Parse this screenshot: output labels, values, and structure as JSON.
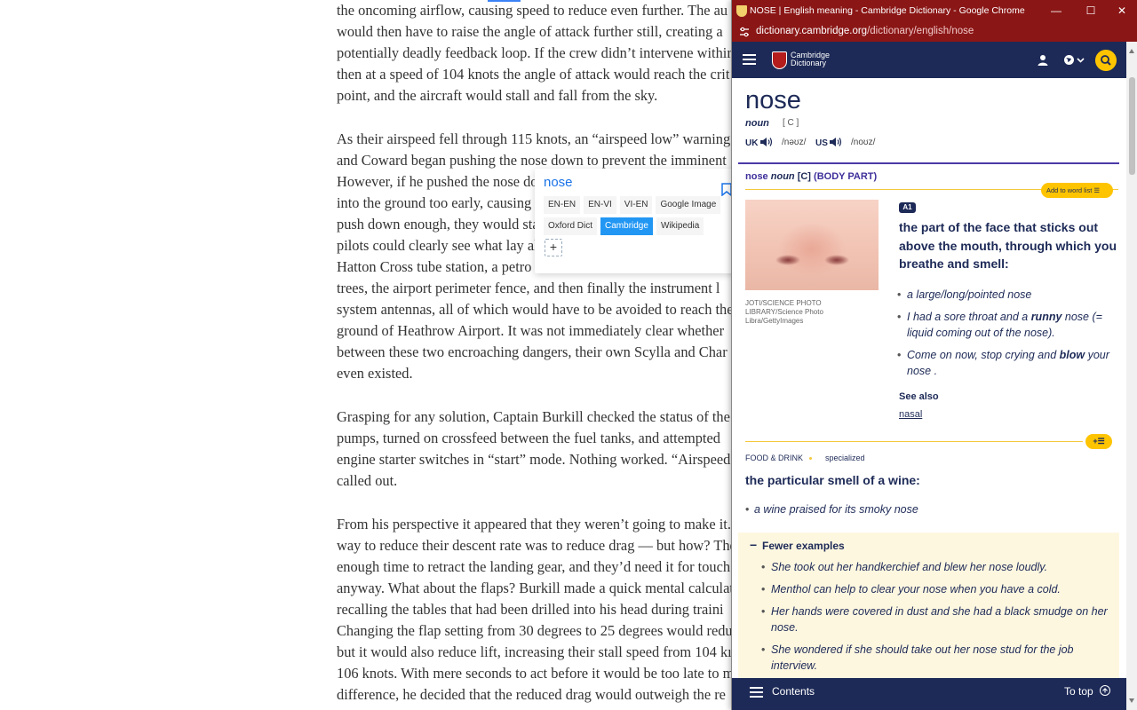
{
  "article": {
    "para1": [
      "the oncoming airflow, causing speed to reduce even further. The au",
      "would then have to raise the angle of attack further still, creating a",
      "potentially deadly feedback loop. If the crew didn’t intervene withir",
      "then at a speed of 104 knots the angle of attack would reach the crit",
      "point, and the aircraft would stall and fall from the sky."
    ],
    "para2": [
      "As their airspeed fell through 115 knots, an “airspeed low” warning",
      "and Coward began pushing the nose down to prevent the imminent",
      "However, if he pushed the nose do",
      "into the ground too early, causing",
      "push down enough, they would sta",
      "pilots could clearly see what lay al",
      "Hatton Cross tube station, a petro",
      "trees, the airport perimeter fence, and then finally the instrument l",
      "system antennas, all of which would have to be avoided to reach the",
      "ground of Heathrow Airport. It was not immediately clear whether",
      "between these two encroaching dangers, their own Scylla and Char",
      "even existed."
    ],
    "para3": [
      "Grasping for any solution, Captain Burkill checked the status of the",
      "pumps, turned on crossfeed between the fuel tanks, and attempted",
      "engine starter switches in “start” mode. Nothing worked. “Airspeed",
      "called out."
    ],
    "para4": [
      "From his perspective it appeared that they weren’t going to make it.",
      "way to reduce their descent rate was to reduce drag — but how? The",
      "enough time to retract the landing gear, and they’d need it for touch",
      "anyway. What about the flaps? Burkill made a quick mental calculat",
      "recalling the tables that had been drilled into his head during traini",
      "Changing the flap setting from 30 degrees to 25 degrees would redu",
      "but it would also reduce lift, increasing their stall speed from 104 kı",
      "106 knots. With mere seconds to act before it would be too late to m",
      "difference, he decided that the reduced drag would outweigh the re"
    ]
  },
  "popup": {
    "word": "nose",
    "row1": [
      "EN-EN",
      "EN-VI",
      "VI-EN",
      "Google Image"
    ],
    "row2": [
      "Oxford Dict",
      "Cambridge",
      "Wikipedia"
    ],
    "active": "Cambridge",
    "plus": "+"
  },
  "window": {
    "title": "NOSE | English meaning - Cambridge Dictionary - Google Chrome",
    "url_host": "dictionary.cambridge.org",
    "url_path": "/dictionary/english/nose",
    "minimize": "—",
    "maximize": "☐",
    "close": "✕"
  },
  "cd": {
    "logo_line1": "Cambridge",
    "logo_line2": "Dictionary",
    "headword": "nose",
    "pos": "noun",
    "gram": "[ C ]",
    "uk_label": "UK",
    "uk_ipa": "/nəʊz/",
    "us_label": "US",
    "us_ipa": "/noʊz/",
    "sense_word": "nose",
    "sense_pos": "noun",
    "sense_gram": "[C]",
    "sense_guide": "(BODY PART)",
    "add_word_list": "Add to word list ☰",
    "add_word_list_short": "+☰",
    "image_credit": "JOTI/SCIENCE PHOTO LIBRARY/Science Photo Libra/GettyImages",
    "level": "A1",
    "definition": "the part of the face that sticks out above the mouth, through which you breathe and smell:",
    "examples": [
      {
        "pre": "a large/long/pointed nose",
        "bold": "",
        "post": ""
      },
      {
        "pre": "I had a sore throat and a ",
        "bold": "runny",
        "post": " nose (= liquid coming out of the nose)."
      },
      {
        "pre": "Come on now, stop crying and ",
        "bold": "blow",
        "post": " your nose ."
      }
    ],
    "see_also": "See also",
    "see_also_link": "nasal",
    "domain": "FOOD & DRINK",
    "specialized": "specialized",
    "definition2": "the particular smell of a wine:",
    "example2": "a wine praised for its smoky nose",
    "fewer_examples": "Fewer examples",
    "more_examples": [
      "She took out her handkerchief and blew her nose loudly.",
      "Menthol can help to clear your nose when you have a cold.",
      "Her hands were covered in dust and she had a black smudge on her nose.",
      "She wondered if she should take out her nose stud for the job interview."
    ],
    "contents": "Contents",
    "to_top": "To top"
  }
}
